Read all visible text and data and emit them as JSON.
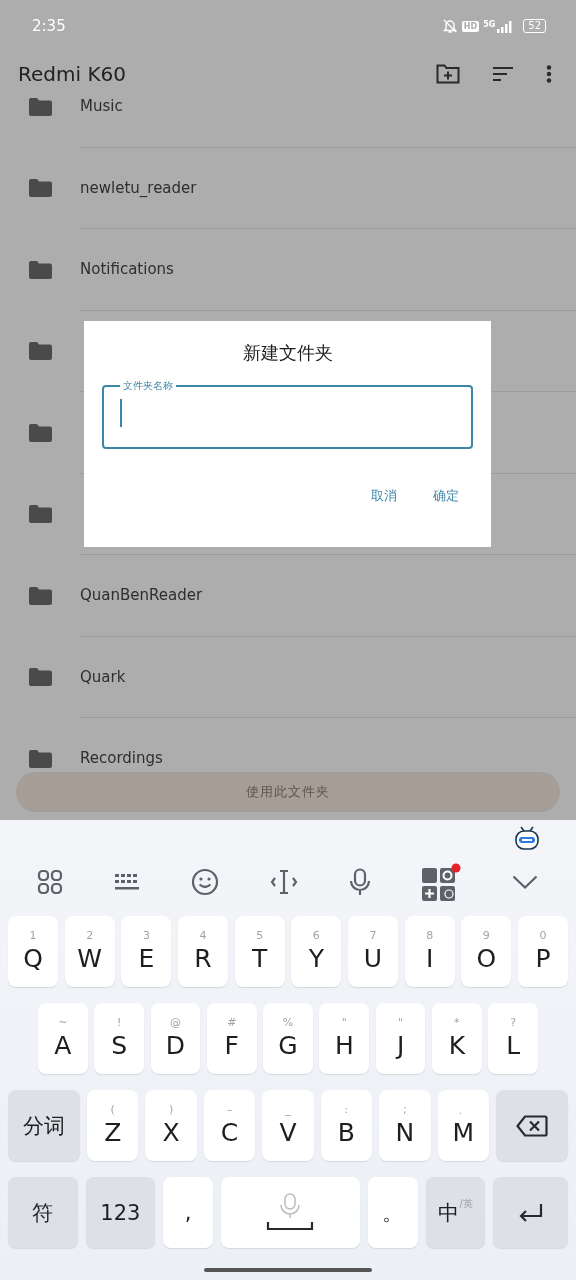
{
  "status_bar": {
    "time": "2:35",
    "hd_badge": "HD",
    "network": "5G",
    "battery": "52"
  },
  "app_bar": {
    "title": "Redmi K60"
  },
  "folders": [
    {
      "kind": "folder",
      "name": "Music"
    },
    {
      "kind": "folder",
      "name": "newletu_reader"
    },
    {
      "kind": "folder",
      "name": "Notifications"
    },
    {
      "kind": "covered"
    },
    {
      "kind": "covered"
    },
    {
      "kind": "covered"
    },
    {
      "kind": "folder",
      "name": "QuanBenReader"
    },
    {
      "kind": "folder",
      "name": "Quark"
    },
    {
      "kind": "folder",
      "name": "Recordings"
    }
  ],
  "use_folder_button": {
    "label": "使用此文件夹"
  },
  "dialog": {
    "title": "新建文件夹",
    "field": {
      "label": "文件夹名称",
      "focused": true
    },
    "buttons": [
      "取消",
      "确定"
    ]
  },
  "keyboard": {
    "rows": [
      {
        "keys": [
          {
            "kind": "letter",
            "label": "Q",
            "hint": "1"
          },
          {
            "kind": "letter",
            "label": "W",
            "hint": "2"
          },
          {
            "kind": "letter",
            "label": "E",
            "hint": "3"
          },
          {
            "kind": "letter",
            "label": "R",
            "hint": "4"
          },
          {
            "kind": "letter",
            "label": "T",
            "hint": "5"
          },
          {
            "kind": "letter",
            "label": "Y",
            "hint": "6"
          },
          {
            "kind": "letter",
            "label": "U",
            "hint": "7"
          },
          {
            "kind": "letter",
            "label": "I",
            "hint": "8"
          },
          {
            "kind": "letter",
            "label": "O",
            "hint": "9"
          },
          {
            "kind": "letter",
            "label": "P",
            "hint": "0"
          }
        ]
      },
      {
        "keys": [
          {
            "kind": "letter",
            "label": "A",
            "hint": "~"
          },
          {
            "kind": "letter",
            "label": "S",
            "hint": "!"
          },
          {
            "kind": "letter",
            "label": "D",
            "hint": "@"
          },
          {
            "kind": "letter",
            "label": "F",
            "hint": "#"
          },
          {
            "kind": "letter",
            "label": "G",
            "hint": "%"
          },
          {
            "kind": "letter",
            "label": "H",
            "hint": "\""
          },
          {
            "kind": "letter",
            "label": "J",
            "hint": "\""
          },
          {
            "kind": "letter",
            "label": "K",
            "hint": "*"
          },
          {
            "kind": "letter",
            "label": "L",
            "hint": "?"
          }
        ]
      },
      {
        "keys": [
          {
            "kind": "function",
            "label": "分词"
          },
          {
            "kind": "letter",
            "label": "Z",
            "hint": "("
          },
          {
            "kind": "letter",
            "label": "X",
            "hint": ")"
          },
          {
            "kind": "letter",
            "label": "C",
            "hint": "–"
          },
          {
            "kind": "letter",
            "label": "V",
            "hint": "_"
          },
          {
            "kind": "letter",
            "label": "B",
            "hint": ":"
          },
          {
            "kind": "letter",
            "label": "N",
            "hint": ";"
          },
          {
            "kind": "letter",
            "label": "M",
            "hint": "、"
          },
          {
            "kind": "backspace"
          }
        ]
      },
      {
        "keys": [
          {
            "kind": "function",
            "label": "符"
          },
          {
            "kind": "function",
            "label": "123"
          },
          {
            "kind": "punct",
            "label": ","
          },
          {
            "kind": "space"
          },
          {
            "kind": "punct",
            "label": "。"
          },
          {
            "kind": "lang",
            "label": "中",
            "hint": "/英"
          },
          {
            "kind": "enter"
          }
        ]
      }
    ]
  }
}
